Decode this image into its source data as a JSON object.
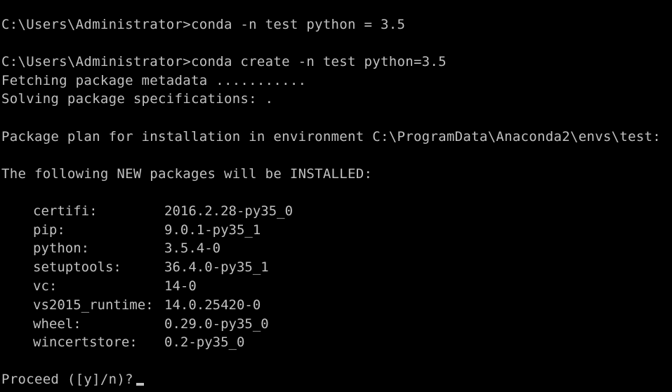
{
  "console": {
    "lines": [
      "C:\\Users\\Administrator>conda -n test python = 3.5",
      "",
      "C:\\Users\\Administrator>conda create -n test python=3.5",
      "Fetching package metadata ...........",
      "Solving package specifications: .",
      "",
      "Package plan for installation in environment C:\\ProgramData\\Anaconda2\\envs\\test:",
      "",
      "The following NEW packages will be INSTALLED:",
      ""
    ],
    "packages": [
      {
        "name": "certifi:",
        "version": "2016.2.28-py35_0"
      },
      {
        "name": "pip:",
        "version": "9.0.1-py35_1"
      },
      {
        "name": "python:",
        "version": "3.5.4-0"
      },
      {
        "name": "setuptools:",
        "version": "36.4.0-py35_1"
      },
      {
        "name": "vc:",
        "version": "14-0"
      },
      {
        "name": "vs2015_runtime:",
        "version": "14.0.25420-0"
      },
      {
        "name": "wheel:",
        "version": "0.29.0-py35_0"
      },
      {
        "name": "wincertstore:",
        "version": "0.2-py35_0"
      }
    ],
    "prompt": "Proceed ([y]/n)?"
  },
  "colors": {
    "background": "#000000",
    "text": "#c0c0c0"
  }
}
